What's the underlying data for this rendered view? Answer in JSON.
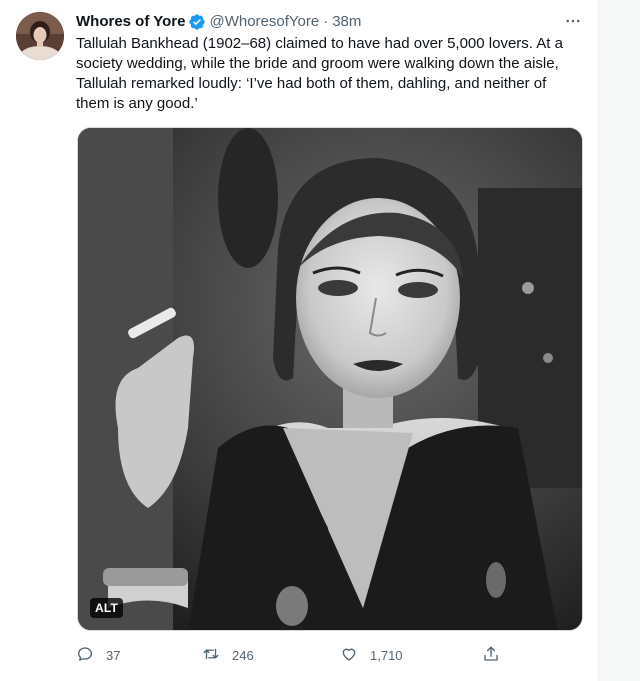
{
  "tweet": {
    "author_name": "Whores of Yore",
    "author_handle": "@WhoresofYore",
    "separator": "·",
    "timestamp": "38m",
    "text_lines": [
      "Tallulah Bankhead (1902–68) claimed to have had over 5,000 lovers. At a",
      "society wedding, while the bride and groom were walking down the aisle,",
      "Tallulah remarked loudly: ‘I’ve had both of them, dahling, and neither of",
      "them is any good.’"
    ],
    "media_alt_badge": "ALT"
  },
  "actions": {
    "reply_count": "37",
    "retweet_count": "246",
    "like_count": "1,710"
  },
  "icons": {
    "verified": "verified-badge-icon",
    "more": "more-horizontal-icon",
    "reply": "reply-icon",
    "retweet": "retweet-icon",
    "like": "heart-icon",
    "share": "share-icon"
  },
  "colors": {
    "verified_blue": "#1d9bf0",
    "secondary_text": "#536471",
    "primary_text": "#0f1419"
  }
}
